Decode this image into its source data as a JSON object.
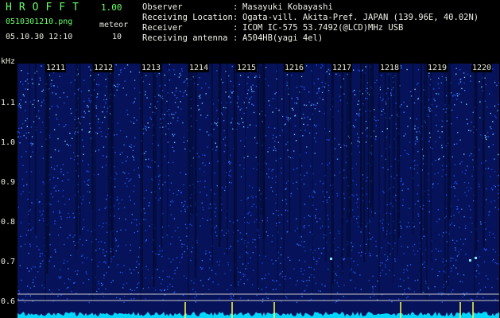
{
  "header": {
    "app_name": "HROFFT",
    "version": "1.00",
    "filename": "0510301210.png",
    "mode": "meteor",
    "datetime": "05.10.30 12:10",
    "count": "10"
  },
  "info": [
    {
      "label": "Observer",
      "value": "Masayuki Kobayashi"
    },
    {
      "label": "Receiving Location",
      "value": "Ogata-vill. Akita-Pref. JAPAN (139.96E, 40.02N)"
    },
    {
      "label": "Receiver",
      "value": "ICOM IC-575 53.7492(@LCD)MHz USB"
    },
    {
      "label": "Receiving antenna",
      "value": "A504HB(yagi 4el)"
    }
  ],
  "axis": {
    "y_unit": "kHz",
    "y_ticks": [
      "1.1",
      "1.0",
      "0.9",
      "0.8",
      "0.7",
      "0.6"
    ],
    "x_ticks": [
      "1211",
      "1212",
      "1213",
      "1214",
      "1215",
      "1216",
      "1217",
      "1218",
      "1219",
      "1220"
    ]
  },
  "colors": {
    "background": "#000000",
    "spectrogram": "#0a2a9c",
    "signal": "#00e5ff",
    "header_green": "#6cff6c",
    "marker": "#ffff40"
  }
}
